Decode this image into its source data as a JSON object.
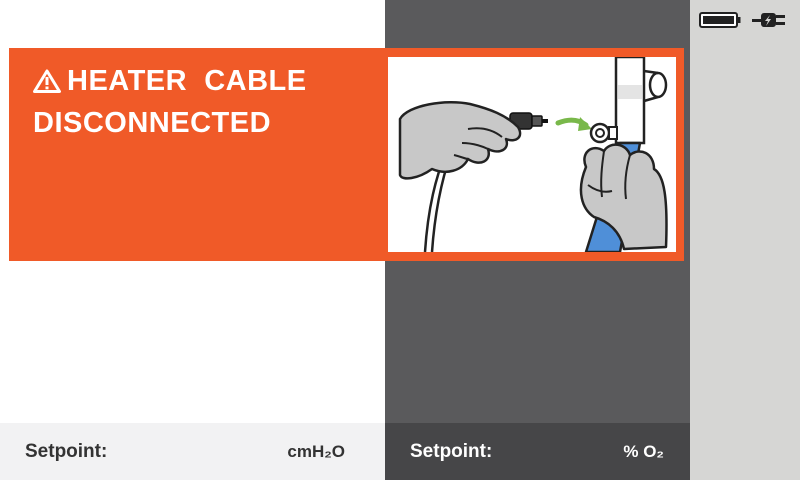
{
  "alarm": {
    "title_line1": "HEATER  CABLE",
    "title_line2": "DISCONNECTED",
    "icon": "warning-triangle-icon",
    "color": "#f05a28"
  },
  "status": {
    "battery_icon": "battery-icon",
    "power_icon": "ac-plug-icon"
  },
  "footer": {
    "left": {
      "label": "Setpoint:",
      "unit": "cmH₂O"
    },
    "right": {
      "label": "Setpoint:",
      "unit": "% O₂"
    }
  },
  "colors": {
    "mid_panel": "#5a5a5c",
    "right_panel": "#d6d6d4",
    "footer_dark": "#464648",
    "arrow_green": "#79b84a",
    "tube_blue": "#4f8fd8"
  }
}
